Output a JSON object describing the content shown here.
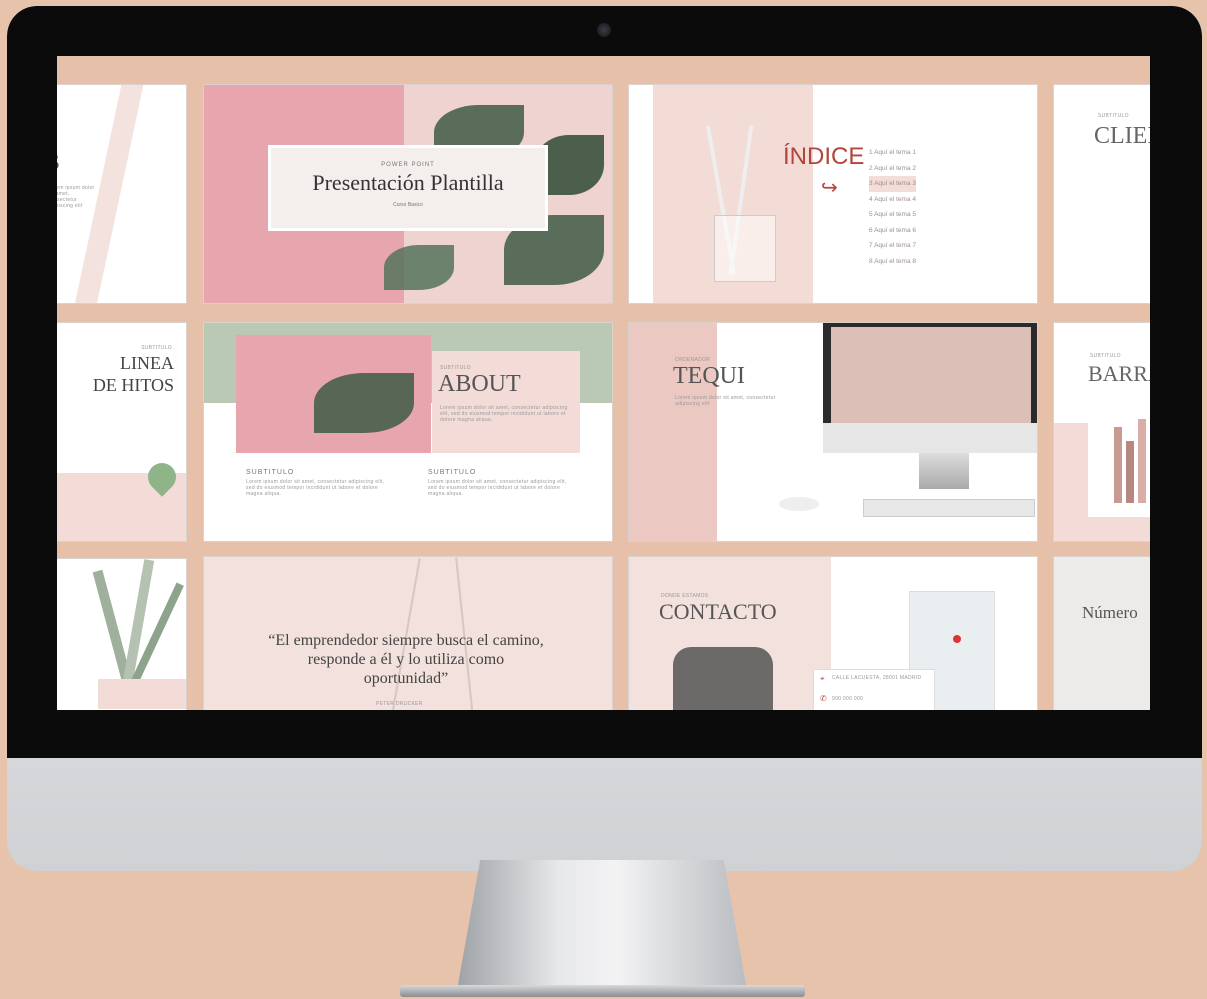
{
  "slides": {
    "s1": {
      "text": "Lorem ipsum dolor sit amet, consectetur adipiscing elit"
    },
    "s2": {
      "small": "POWER POINT",
      "title": "Presentación Plantilla",
      "sub": "Curso Basico"
    },
    "s3": {
      "title": "ÍNDICE",
      "items": [
        "Aquí el tema 1",
        "Aquí el tema 2",
        "Aquí el tema 3",
        "Aquí el tema 4",
        "Aquí el tema 5",
        "Aquí el tema 6",
        "Aquí el tema 7",
        "Aquí el tema 8"
      ]
    },
    "s4": {
      "small": "SUBTITULO",
      "title": "CLIEN"
    },
    "s5": {
      "small": "SUBTITULO",
      "title1": "LINEA",
      "title2": "DE HITOS"
    },
    "s6": {
      "small": "SUBTITULO",
      "title": "ABOUT",
      "col1": "SUBTITULO",
      "col2": "SUBTITULO",
      "body": "Lorem ipsum dolor sit amet, consectetur adipiscing elit, sed do eiusmod tempor incididunt ut labore et dolore magna aliqua."
    },
    "s7": {
      "small": "ORDENADOR",
      "title": "TEQUI"
    },
    "s8": {
      "small": "SUBTITULO",
      "title": "BARRA"
    },
    "s10": {
      "quote": "“El emprendedor siempre busca el camino, responde a él y lo utiliza como oportunidad”",
      "author": "PETER DRUCKER"
    },
    "s11": {
      "small": "DONDE ESTAMOS",
      "title": "CONTACTO",
      "address": "CALLE LACUESTA, 28001 MADRID",
      "phone": "900 000 000"
    },
    "s12": {
      "title": "Número"
    }
  },
  "colors": {
    "background": "#e8c3ab",
    "accent": "#b5443c",
    "sage": "#b9c9b3",
    "blush": "#f3dcd8"
  }
}
